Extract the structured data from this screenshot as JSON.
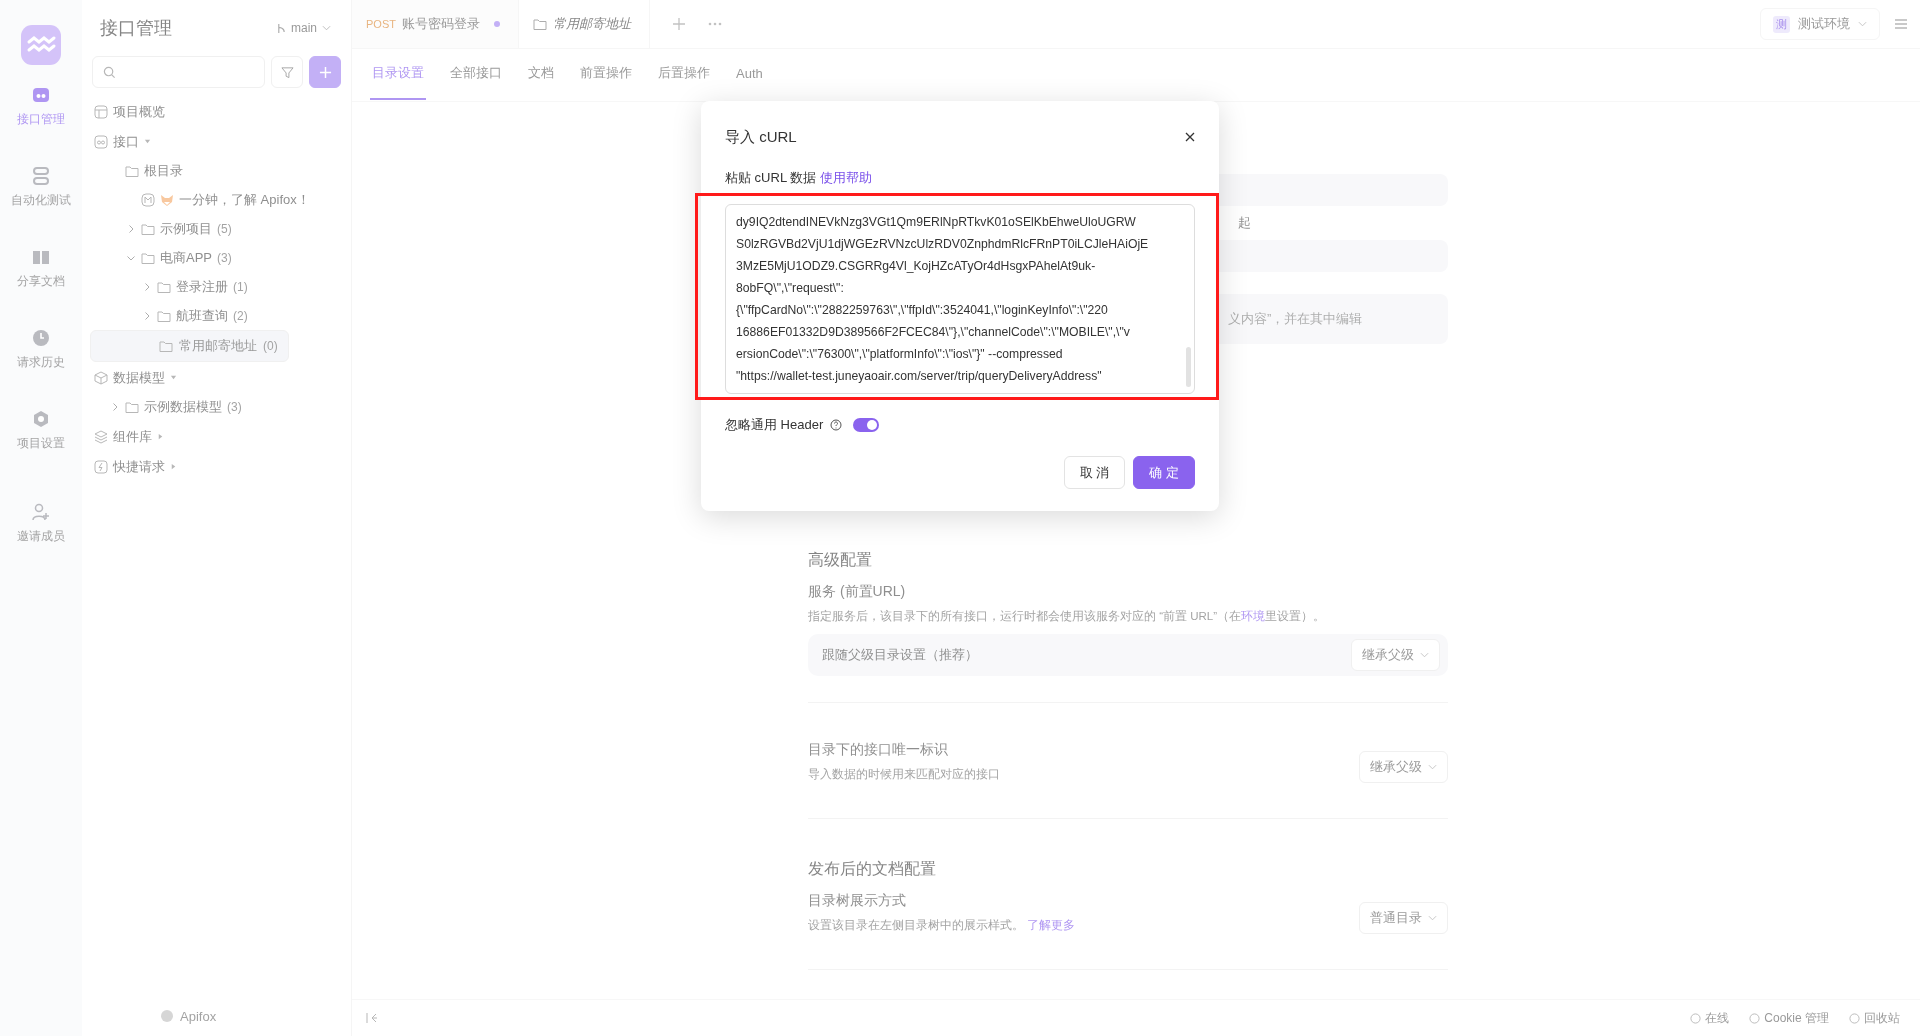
{
  "rail": {
    "items": [
      {
        "kind": "api",
        "label": "接口管理",
        "selected": true
      },
      {
        "kind": "auto",
        "label": "自动化测试",
        "selected": false
      },
      {
        "kind": "share",
        "label": "分享文档",
        "selected": false
      },
      {
        "kind": "history",
        "label": "请求历史",
        "selected": false
      },
      {
        "kind": "settings",
        "label": "项目设置",
        "selected": false
      },
      {
        "kind": "invite",
        "label": "邀请成员",
        "selected": false
      }
    ]
  },
  "panel": {
    "title": "接口管理",
    "branch": "main",
    "footer_logo": "Apifox"
  },
  "tree": [
    {
      "kind": "overview",
      "label": "项目概览"
    },
    {
      "kind": "api",
      "label": "接口",
      "expanded": true,
      "children": [
        {
          "kind": "root",
          "label": "根目录",
          "children": [
            {
              "kind": "doc",
              "label": "一分钟，了解 Apifox！",
              "selected": false
            },
            {
              "kind": "folder",
              "label": "示例项目",
              "count": "(5)",
              "expanded": false,
              "selected": false
            },
            {
              "kind": "folder",
              "label": "电商APP",
              "count": "(3)",
              "expanded": true,
              "selected": false,
              "children": [
                {
                  "kind": "folder",
                  "label": "登录注册",
                  "count": "(1)",
                  "expanded": false,
                  "selected": false
                },
                {
                  "kind": "folder",
                  "label": "航班查询",
                  "count": "(2)",
                  "expanded": false,
                  "selected": false
                },
                {
                  "kind": "empty-folder",
                  "label": "常用邮寄地址",
                  "count": "(0)",
                  "selected": true
                }
              ]
            }
          ]
        }
      ]
    },
    {
      "kind": "model",
      "label": "数据模型",
      "expanded": true,
      "children": [
        {
          "kind": "folder",
          "label": "示例数据模型",
          "count": "(3)",
          "expanded": false,
          "selected": false
        }
      ]
    },
    {
      "kind": "components",
      "label": "组件库",
      "expanded": false
    },
    {
      "kind": "quick",
      "label": "快捷请求",
      "expanded": false
    }
  ],
  "tabs": [
    {
      "kind": "request",
      "method": "POST",
      "label": "账号密码登录",
      "modified": true,
      "selected": false
    },
    {
      "kind": "folder",
      "label": "常用邮寄地址",
      "selected": true
    }
  ],
  "env": {
    "badge": "测",
    "label": "测试环境"
  },
  "subtabs": [
    {
      "label": "目录设置",
      "selected": true
    },
    {
      "label": "全部接口",
      "selected": false
    },
    {
      "label": "文档",
      "selected": false
    },
    {
      "label": "前置操作",
      "selected": false
    },
    {
      "label": "后置操作",
      "selected": false
    },
    {
      "label": "Auth",
      "selected": false
    }
  ],
  "content": {
    "label_tail": "起",
    "placeholder_tail": "义内容”，并在其中编辑",
    "advanced": {
      "heading": "高级配置",
      "service_label": "服务 (前置URL)",
      "service_desc_before": "指定服务后，该目录下的所有接口，运行时都会使用该服务对应的 “前置 URL”（在",
      "service_desc_link": "环境",
      "service_desc_after": "里设置）。",
      "service_option": "跟随父级目录设置（推荐）",
      "service_select": "继承父级",
      "id_label": "目录下的接口唯一标识",
      "id_desc": "导入数据的时候用来匹配对应的接口",
      "id_select": "继承父级"
    },
    "docs": {
      "heading": "发布后的文档配置",
      "tree_label": "目录树展示方式",
      "tree_desc": "设置该目录在左侧目录树中的展示样式。",
      "tree_link": "了解更多",
      "tree_select": "普通目录"
    }
  },
  "status_bar": [
    "在线",
    "Cookie 管理",
    "回收站"
  ],
  "modal": {
    "title": "导入 cURL",
    "field_label": "粘贴 cURL 数据",
    "help_link": "使用帮助",
    "curl_lines": [
      "dy9IQ2dtendINEVkNzg3VGt1Qm9ERlNpRTkvK01oSElKbEhweUloUGRW",
      "S0lzRGVBd2VjU1djWGEzRVNzcUlzRDV0ZnphdmRlcFRnPT0iLCJleHAiOjE",
      "3MzE5MjU1ODZ9.CSGRRg4Vl_KojHZcATyOr4dHsgxPAhelAt9uk-",
      "8obFQ\\\",\\\"request\\\":",
      "{\\\"ffpCardNo\\\":\\\"2882259763\\\",\\\"ffpId\\\":3524041,\\\"loginKeyInfo\\\":\\\"220",
      "16886EF01332D9D389566F2FCEC84\\\"},\\\"channelCode\\\":\\\"MOBILE\\\",\\\"v",
      "ersionCode\\\":\\\"76300\\\",\\\"platformInfo\\\":\\\"ios\\\"}\" --compressed",
      "\"https://wallet-test.juneyaoair.com/server/trip/queryDeliveryAddress\""
    ],
    "toggle_label": "忽略通用 Header",
    "toggle_on": true,
    "cancel": "取 消",
    "ok": "确 定"
  }
}
